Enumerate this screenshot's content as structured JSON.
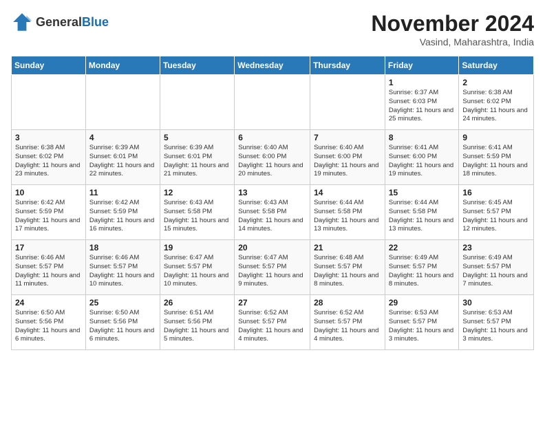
{
  "header": {
    "logo": {
      "general": "General",
      "blue": "Blue"
    },
    "title": "November 2024",
    "location": "Vasind, Maharashtra, India"
  },
  "weekdays": [
    "Sunday",
    "Monday",
    "Tuesday",
    "Wednesday",
    "Thursday",
    "Friday",
    "Saturday"
  ],
  "weeks": [
    [
      {
        "day": "",
        "info": ""
      },
      {
        "day": "",
        "info": ""
      },
      {
        "day": "",
        "info": ""
      },
      {
        "day": "",
        "info": ""
      },
      {
        "day": "",
        "info": ""
      },
      {
        "day": "1",
        "info": "Sunrise: 6:37 AM\nSunset: 6:03 PM\nDaylight: 11 hours and 25 minutes."
      },
      {
        "day": "2",
        "info": "Sunrise: 6:38 AM\nSunset: 6:02 PM\nDaylight: 11 hours and 24 minutes."
      }
    ],
    [
      {
        "day": "3",
        "info": "Sunrise: 6:38 AM\nSunset: 6:02 PM\nDaylight: 11 hours and 23 minutes."
      },
      {
        "day": "4",
        "info": "Sunrise: 6:39 AM\nSunset: 6:01 PM\nDaylight: 11 hours and 22 minutes."
      },
      {
        "day": "5",
        "info": "Sunrise: 6:39 AM\nSunset: 6:01 PM\nDaylight: 11 hours and 21 minutes."
      },
      {
        "day": "6",
        "info": "Sunrise: 6:40 AM\nSunset: 6:00 PM\nDaylight: 11 hours and 20 minutes."
      },
      {
        "day": "7",
        "info": "Sunrise: 6:40 AM\nSunset: 6:00 PM\nDaylight: 11 hours and 19 minutes."
      },
      {
        "day": "8",
        "info": "Sunrise: 6:41 AM\nSunset: 6:00 PM\nDaylight: 11 hours and 19 minutes."
      },
      {
        "day": "9",
        "info": "Sunrise: 6:41 AM\nSunset: 5:59 PM\nDaylight: 11 hours and 18 minutes."
      }
    ],
    [
      {
        "day": "10",
        "info": "Sunrise: 6:42 AM\nSunset: 5:59 PM\nDaylight: 11 hours and 17 minutes."
      },
      {
        "day": "11",
        "info": "Sunrise: 6:42 AM\nSunset: 5:59 PM\nDaylight: 11 hours and 16 minutes."
      },
      {
        "day": "12",
        "info": "Sunrise: 6:43 AM\nSunset: 5:58 PM\nDaylight: 11 hours and 15 minutes."
      },
      {
        "day": "13",
        "info": "Sunrise: 6:43 AM\nSunset: 5:58 PM\nDaylight: 11 hours and 14 minutes."
      },
      {
        "day": "14",
        "info": "Sunrise: 6:44 AM\nSunset: 5:58 PM\nDaylight: 11 hours and 13 minutes."
      },
      {
        "day": "15",
        "info": "Sunrise: 6:44 AM\nSunset: 5:58 PM\nDaylight: 11 hours and 13 minutes."
      },
      {
        "day": "16",
        "info": "Sunrise: 6:45 AM\nSunset: 5:57 PM\nDaylight: 11 hours and 12 minutes."
      }
    ],
    [
      {
        "day": "17",
        "info": "Sunrise: 6:46 AM\nSunset: 5:57 PM\nDaylight: 11 hours and 11 minutes."
      },
      {
        "day": "18",
        "info": "Sunrise: 6:46 AM\nSunset: 5:57 PM\nDaylight: 11 hours and 10 minutes."
      },
      {
        "day": "19",
        "info": "Sunrise: 6:47 AM\nSunset: 5:57 PM\nDaylight: 11 hours and 10 minutes."
      },
      {
        "day": "20",
        "info": "Sunrise: 6:47 AM\nSunset: 5:57 PM\nDaylight: 11 hours and 9 minutes."
      },
      {
        "day": "21",
        "info": "Sunrise: 6:48 AM\nSunset: 5:57 PM\nDaylight: 11 hours and 8 minutes."
      },
      {
        "day": "22",
        "info": "Sunrise: 6:49 AM\nSunset: 5:57 PM\nDaylight: 11 hours and 8 minutes."
      },
      {
        "day": "23",
        "info": "Sunrise: 6:49 AM\nSunset: 5:57 PM\nDaylight: 11 hours and 7 minutes."
      }
    ],
    [
      {
        "day": "24",
        "info": "Sunrise: 6:50 AM\nSunset: 5:56 PM\nDaylight: 11 hours and 6 minutes."
      },
      {
        "day": "25",
        "info": "Sunrise: 6:50 AM\nSunset: 5:56 PM\nDaylight: 11 hours and 6 minutes."
      },
      {
        "day": "26",
        "info": "Sunrise: 6:51 AM\nSunset: 5:56 PM\nDaylight: 11 hours and 5 minutes."
      },
      {
        "day": "27",
        "info": "Sunrise: 6:52 AM\nSunset: 5:57 PM\nDaylight: 11 hours and 4 minutes."
      },
      {
        "day": "28",
        "info": "Sunrise: 6:52 AM\nSunset: 5:57 PM\nDaylight: 11 hours and 4 minutes."
      },
      {
        "day": "29",
        "info": "Sunrise: 6:53 AM\nSunset: 5:57 PM\nDaylight: 11 hours and 3 minutes."
      },
      {
        "day": "30",
        "info": "Sunrise: 6:53 AM\nSunset: 5:57 PM\nDaylight: 11 hours and 3 minutes."
      }
    ]
  ]
}
